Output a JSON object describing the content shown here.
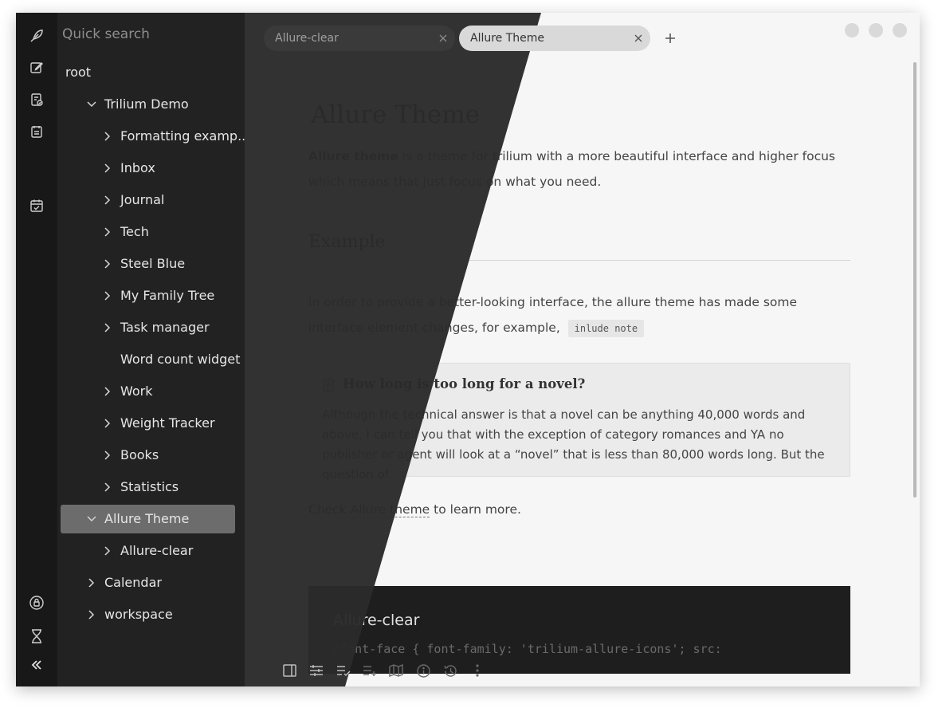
{
  "sidebar": {
    "search_placeholder": "Quick search",
    "tree": [
      {
        "label": "root",
        "chevron": "none",
        "level": 0,
        "active": false
      },
      {
        "label": "Trilium Demo",
        "chevron": "down",
        "level": 1,
        "active": false
      },
      {
        "label": "Formatting examp...",
        "chevron": "right",
        "level": 2,
        "active": false
      },
      {
        "label": "Inbox",
        "chevron": "right",
        "level": 2,
        "active": false
      },
      {
        "label": "Journal",
        "chevron": "right",
        "level": 2,
        "active": false
      },
      {
        "label": "Tech",
        "chevron": "right",
        "level": 2,
        "active": false
      },
      {
        "label": "Steel Blue",
        "chevron": "right",
        "level": 2,
        "active": false
      },
      {
        "label": "My Family Tree",
        "chevron": "right",
        "level": 2,
        "active": false
      },
      {
        "label": "Task manager",
        "chevron": "right",
        "level": 2,
        "active": false
      },
      {
        "label": "Word count widget",
        "chevron": "none",
        "level": 2,
        "active": false
      },
      {
        "label": "Work",
        "chevron": "right",
        "level": 2,
        "active": false
      },
      {
        "label": "Weight Tracker",
        "chevron": "right",
        "level": 2,
        "active": false
      },
      {
        "label": "Books",
        "chevron": "right",
        "level": 2,
        "active": false
      },
      {
        "label": "Statistics",
        "chevron": "right",
        "level": 2,
        "active": false
      },
      {
        "label": "Allure Theme",
        "chevron": "down",
        "level": 1,
        "active": true
      },
      {
        "label": "Allure-clear",
        "chevron": "right",
        "level": 2,
        "active": false
      },
      {
        "label": "Calendar",
        "chevron": "right",
        "level": 1,
        "active": false
      },
      {
        "label": "workspace",
        "chevron": "right",
        "level": 1,
        "active": false
      }
    ]
  },
  "launcher": {
    "icons": [
      "new-note-icon",
      "edit-note-icon",
      "note-map-icon",
      "recent-changes-icon",
      "calendar-icon",
      "protected-session-icon",
      "hourglass-icon",
      "collapse-sidebar-icon"
    ]
  },
  "tabs": [
    {
      "label": "Allure-clear",
      "active": false
    },
    {
      "label": "Allure Theme",
      "active": true
    }
  ],
  "note": {
    "title": "Allure Theme",
    "intro_bold": "Allure theme",
    "intro_rest": " is a theme for trilium with a more beautiful interface and higher focus which means that just focus on what you need.",
    "section_heading": "Example",
    "para2": "In order to provide a better-looking interface, the allure theme has made some interface element changes, for example,",
    "inline_code": "inlude note",
    "included_note": {
      "title": "How long is too long for a novel?",
      "body": "Although the technical answer is that a novel can be anything 40,000 words and above, I can tell you that with the exception of category romances and YA no publisher or agent will look at a “novel” that is less than 80,000 words long. But the question of"
    },
    "check_prefix": "Check ",
    "check_link": "Allure theme",
    "check_suffix": " to learn more.",
    "codeblock": {
      "title": "Allure-clear",
      "line": "@font-face { font-family: 'trilium-allure-icons'; src:"
    }
  },
  "bottom_toolbar": {
    "icons": [
      "toggle-right-pane-icon",
      "note-properties-icon",
      "checklist-icon",
      "insert-icon",
      "book-map-icon",
      "info-icon",
      "history-icon",
      "more-icon"
    ]
  },
  "colors": {
    "dark_bg": "#2b2b2b",
    "sidebar_bg": "#222222",
    "launcher_bg": "#181818",
    "light_bg": "#f6f6f6",
    "active_item": "#6c6c6c"
  }
}
